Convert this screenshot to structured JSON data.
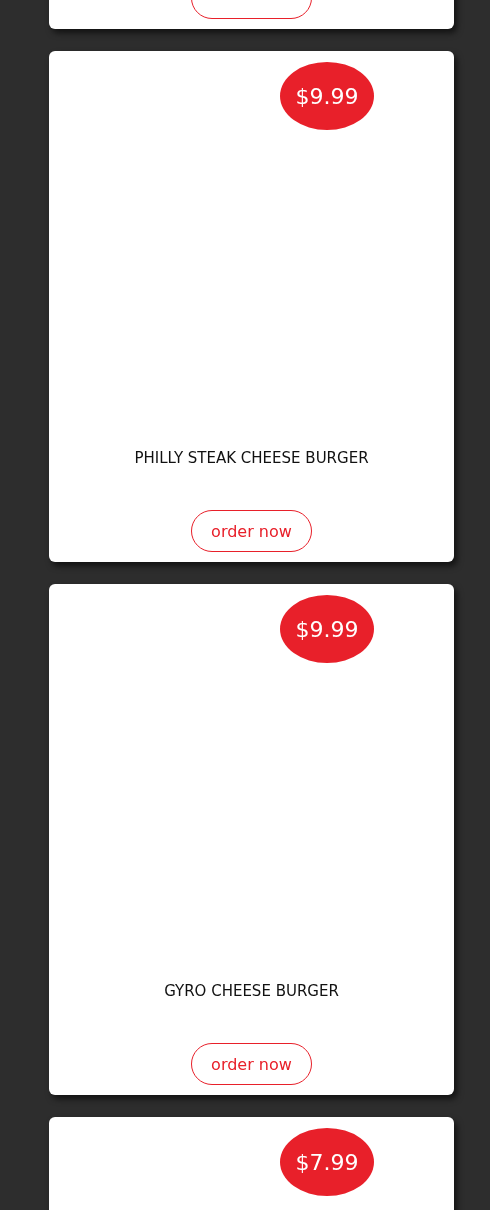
{
  "menu_items": [
    {
      "kind": "cut"
    },
    {
      "price": "$9.99",
      "title": "PHILLY STEAK CHEESE BURGER",
      "button": "order now"
    },
    {
      "price": "$9.99",
      "title": "GYRO CHEESE BURGER",
      "button": "order now"
    },
    {
      "price": "$7.99"
    }
  ]
}
